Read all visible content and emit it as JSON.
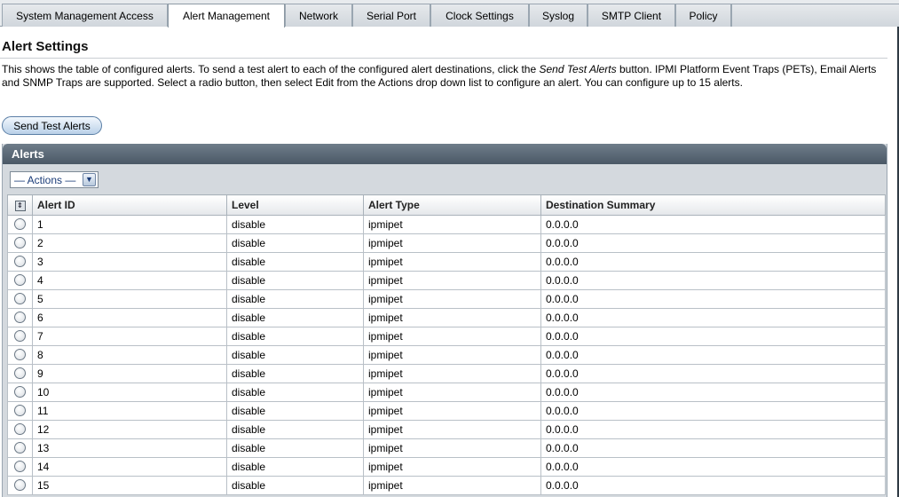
{
  "tabs": [
    {
      "label": "System Management Access",
      "active": false
    },
    {
      "label": "Alert Management",
      "active": true
    },
    {
      "label": "Network",
      "active": false
    },
    {
      "label": "Serial Port",
      "active": false
    },
    {
      "label": "Clock Settings",
      "active": false
    },
    {
      "label": "Syslog",
      "active": false
    },
    {
      "label": "SMTP Client",
      "active": false
    },
    {
      "label": "Policy",
      "active": false
    }
  ],
  "page": {
    "title": "Alert Settings",
    "description_part1": "This shows the table of configured alerts. To send a test alert to each of the configured alert destinations, click the ",
    "description_emph": "Send Test Alerts",
    "description_part2": " button. IPMI Platform Event Traps (PETs), Email Alerts and SNMP Traps are supported. Select a radio button, then select Edit from the Actions drop down list to configure an alert. You can configure up to 15 alerts.",
    "send_test_button": "Send Test Alerts"
  },
  "panel": {
    "title": "Alerts",
    "actions_label": "— Actions —"
  },
  "table": {
    "columns": [
      "Alert ID",
      "Level",
      "Alert Type",
      "Destination Summary"
    ],
    "rows": [
      {
        "id": "1",
        "level": "disable",
        "type": "ipmipet",
        "dest": "0.0.0.0"
      },
      {
        "id": "2",
        "level": "disable",
        "type": "ipmipet",
        "dest": "0.0.0.0"
      },
      {
        "id": "3",
        "level": "disable",
        "type": "ipmipet",
        "dest": "0.0.0.0"
      },
      {
        "id": "4",
        "level": "disable",
        "type": "ipmipet",
        "dest": "0.0.0.0"
      },
      {
        "id": "5",
        "level": "disable",
        "type": "ipmipet",
        "dest": "0.0.0.0"
      },
      {
        "id": "6",
        "level": "disable",
        "type": "ipmipet",
        "dest": "0.0.0.0"
      },
      {
        "id": "7",
        "level": "disable",
        "type": "ipmipet",
        "dest": "0.0.0.0"
      },
      {
        "id": "8",
        "level": "disable",
        "type": "ipmipet",
        "dest": "0.0.0.0"
      },
      {
        "id": "9",
        "level": "disable",
        "type": "ipmipet",
        "dest": "0.0.0.0"
      },
      {
        "id": "10",
        "level": "disable",
        "type": "ipmipet",
        "dest": "0.0.0.0"
      },
      {
        "id": "11",
        "level": "disable",
        "type": "ipmipet",
        "dest": "0.0.0.0"
      },
      {
        "id": "12",
        "level": "disable",
        "type": "ipmipet",
        "dest": "0.0.0.0"
      },
      {
        "id": "13",
        "level": "disable",
        "type": "ipmipet",
        "dest": "0.0.0.0"
      },
      {
        "id": "14",
        "level": "disable",
        "type": "ipmipet",
        "dest": "0.0.0.0"
      },
      {
        "id": "15",
        "level": "disable",
        "type": "ipmipet",
        "dest": "0.0.0.0"
      }
    ]
  },
  "colors": {
    "panel_header": "#4a5866",
    "button_border": "#5b7fa6",
    "actions_text": "#1a3c78"
  },
  "icons": {
    "select_all": "select-all-icon",
    "actions_dropdown": "chevron-down-icon",
    "row_select": "radio-button"
  }
}
